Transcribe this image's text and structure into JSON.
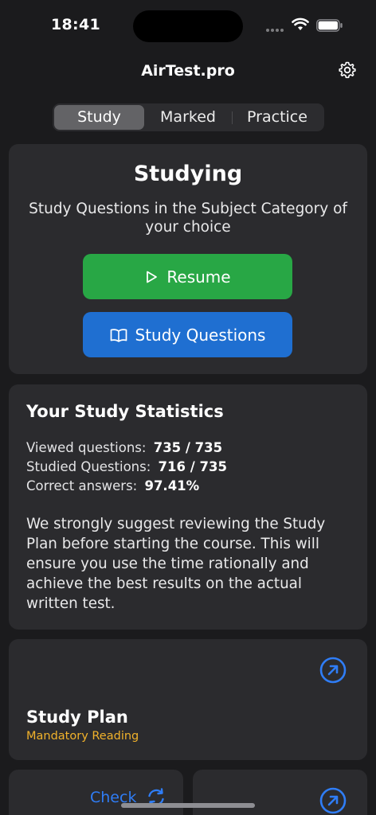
{
  "status": {
    "time": "18:41"
  },
  "nav": {
    "title": "AirTest.pro"
  },
  "tabs": [
    {
      "label": "Study",
      "active": true
    },
    {
      "label": "Marked",
      "active": false
    },
    {
      "label": "Practice",
      "active": false
    }
  ],
  "studying": {
    "title": "Studying",
    "subtitle": "Study Questions in the Subject Category of your choice",
    "resume_label": "Resume",
    "study_questions_label": "Study Questions"
  },
  "stats": {
    "title": "Your Study Statistics",
    "rows": [
      {
        "label": "Viewed questions:",
        "value": "735 / 735"
      },
      {
        "label": "Studied Questions:",
        "value": "716 / 735"
      },
      {
        "label": "Correct answers:",
        "value": "97.41%"
      }
    ],
    "paragraph": "We strongly suggest reviewing the Study Plan before starting the course. This will ensure you use the time rationally and achieve the best results on the actual written test."
  },
  "study_plan": {
    "title": "Study Plan",
    "subtitle": "Mandatory Reading"
  },
  "check_card": {
    "label": "Check"
  },
  "colors": {
    "background": "#1b1b1d",
    "card": "#2b2b2e",
    "green": "#28a745",
    "blue": "#1f6fd1",
    "link": "#2f7df6",
    "accent_yellow": "#f1b22b"
  },
  "icons": [
    "gear-icon",
    "play-icon",
    "book-icon",
    "arrow-up-right-circle-icon",
    "refresh-icon",
    "wifi-icon",
    "battery-icon"
  ]
}
